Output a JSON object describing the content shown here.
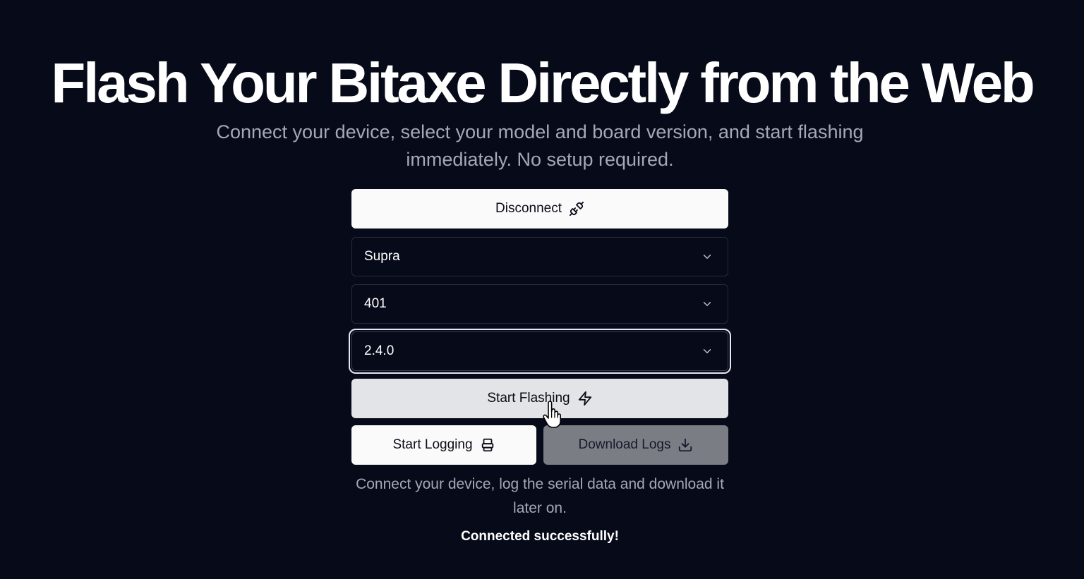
{
  "hero": {
    "title": "Flash Your Bitaxe Directly from the Web",
    "subtitle": "Connect your device, select your model and board version, and start flashing immediately. No setup required."
  },
  "connection": {
    "disconnect_label": "Disconnect",
    "disconnect_icon": "unplug-icon"
  },
  "selects": {
    "model": {
      "value": "Supra"
    },
    "board": {
      "value": "401"
    },
    "firmware": {
      "value": "2.4.0"
    }
  },
  "actions": {
    "flash_label": "Start Flashing",
    "flash_icon": "lightning-icon",
    "log_label": "Start Logging",
    "log_icon": "printer-icon",
    "download_label": "Download Logs",
    "download_icon": "download-icon"
  },
  "hint": "Connect your device, log the serial data and download it later on.",
  "status": "Connected successfully!",
  "colors": {
    "background": "#070a18",
    "primary_button": "#fafafa",
    "disabled_button": "#7b7d85",
    "muted_text": "#a3a9b8"
  }
}
